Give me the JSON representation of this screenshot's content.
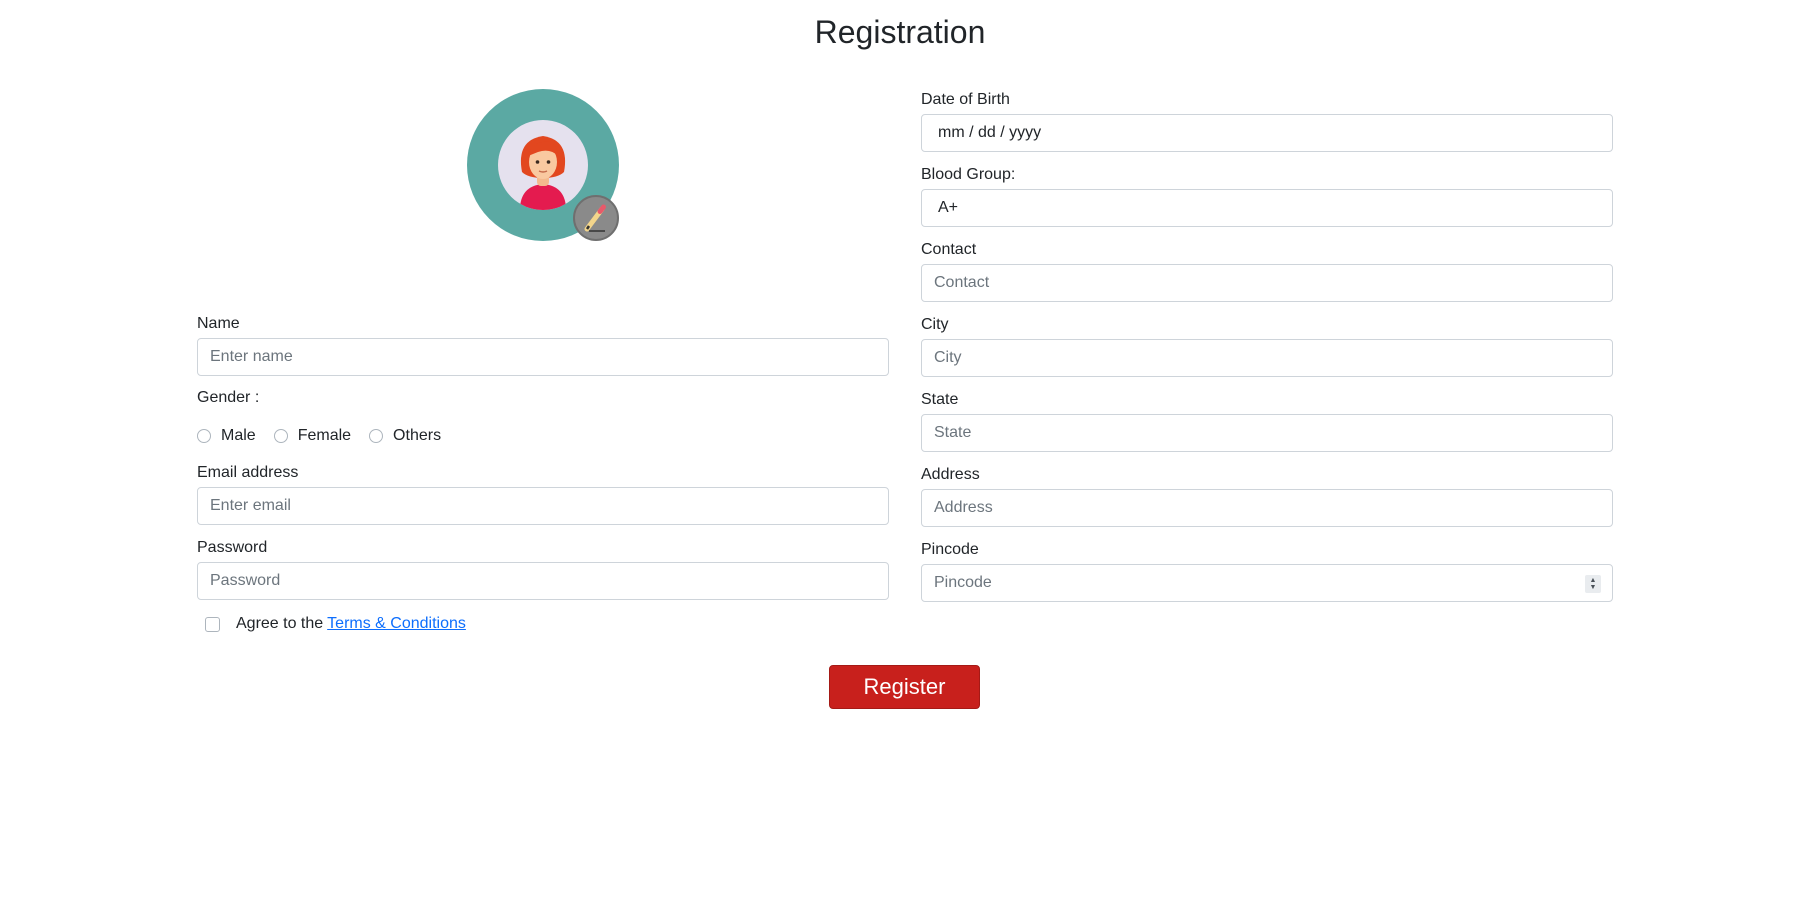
{
  "page": {
    "title": "Registration"
  },
  "avatar": {
    "edit_icon": "pencil-icon"
  },
  "left": {
    "name": {
      "label": "Name",
      "placeholder": "Enter name"
    },
    "gender": {
      "label": "Gender :",
      "options": [
        "Male",
        "Female",
        "Others"
      ]
    },
    "email": {
      "label": "Email address",
      "placeholder": "Enter email"
    },
    "password": {
      "label": "Password",
      "placeholder": "Password"
    },
    "terms": {
      "prefix": "Agree to the",
      "link": "Terms & Conditions"
    }
  },
  "right": {
    "dob": {
      "label": "Date of Birth",
      "value": "mm / dd / yyyy"
    },
    "blood": {
      "label": "Blood Group:",
      "value": "A+"
    },
    "contact": {
      "label": "Contact",
      "placeholder": "Contact"
    },
    "city": {
      "label": "City",
      "placeholder": "City"
    },
    "state": {
      "label": "State",
      "placeholder": "State"
    },
    "address": {
      "label": "Address",
      "placeholder": "Address"
    },
    "pincode": {
      "label": "Pincode",
      "placeholder": "Pincode"
    }
  },
  "actions": {
    "register_label": "Register"
  },
  "colors": {
    "accent": "#c8201c",
    "avatar_ring": "#5ba9a3",
    "link": "#0d6efd"
  }
}
